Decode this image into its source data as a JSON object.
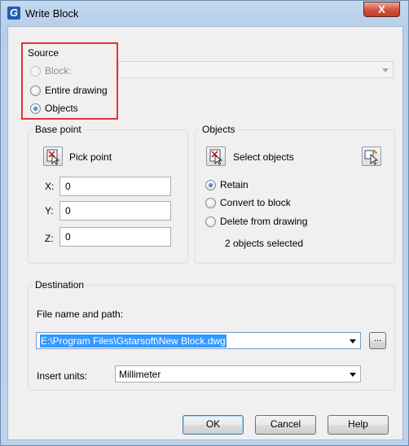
{
  "window": {
    "title": "Write Block",
    "app_icon": "G",
    "close_glyph": "X"
  },
  "source": {
    "title": "Source",
    "options": [
      {
        "label": "Block:",
        "selected": false,
        "disabled": true
      },
      {
        "label": "Entire drawing",
        "selected": false,
        "disabled": false
      },
      {
        "label": "Objects",
        "selected": true,
        "disabled": false
      }
    ],
    "block_combo_value": ""
  },
  "base_point": {
    "title": "Base point",
    "pick_label": "Pick point",
    "x_label": "X:",
    "x_value": "0",
    "y_label": "Y:",
    "y_value": "0",
    "z_label": "Z:",
    "z_value": "0"
  },
  "objects": {
    "title": "Objects",
    "select_label": "Select objects",
    "options": [
      {
        "label": "Retain",
        "selected": true
      },
      {
        "label": "Convert to block",
        "selected": false
      },
      {
        "label": "Delete from drawing",
        "selected": false
      }
    ],
    "status": "2 objects selected"
  },
  "destination": {
    "title": "Destination",
    "file_label": "File name and path:",
    "file_value": "E:\\Program Files\\Gstarsoft\\New Block.dwg",
    "browse_label": "...",
    "units_label": "Insert units:",
    "units_value": "Millimeter"
  },
  "buttons": {
    "ok": "OK",
    "cancel": "Cancel",
    "help": "Help"
  },
  "icons": {
    "app": "gstarcad-logo-icon",
    "pick_point": "pick-point-icon",
    "select_objects": "select-objects-icon",
    "quick_select": "quick-select-icon"
  },
  "colors": {
    "highlight": "#e53434",
    "selection": "#3399ff"
  }
}
